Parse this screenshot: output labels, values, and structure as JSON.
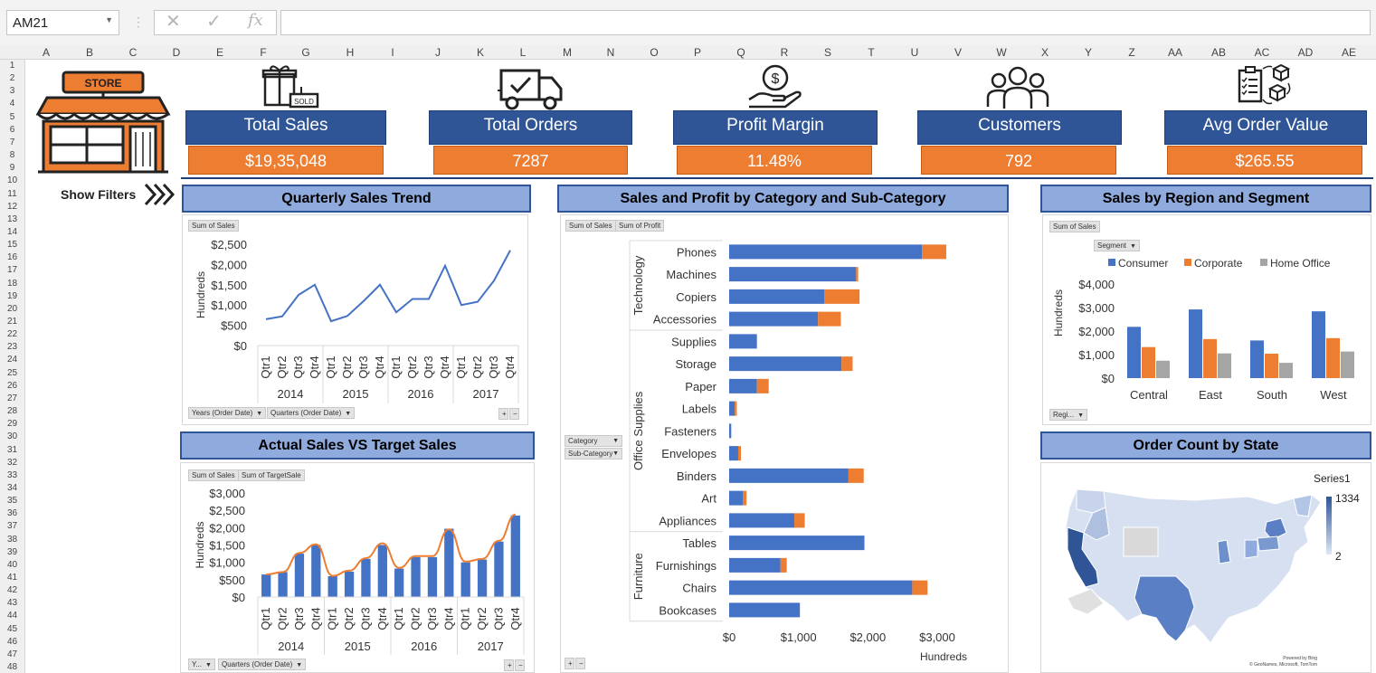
{
  "formula_bar": {
    "name_box": "AM21",
    "fx_label": "fx"
  },
  "columns": [
    "A",
    "B",
    "C",
    "D",
    "E",
    "F",
    "G",
    "H",
    "I",
    "J",
    "K",
    "L",
    "M",
    "N",
    "O",
    "P",
    "Q",
    "R",
    "S",
    "T",
    "U",
    "V",
    "W",
    "X",
    "Y",
    "Z",
    "AA",
    "AB",
    "AC",
    "AD",
    "AE"
  ],
  "rows": [
    "1",
    "2",
    "3",
    "4",
    "5",
    "6",
    "7",
    "8",
    "9",
    "10",
    "11",
    "12",
    "13",
    "14",
    "15",
    "16",
    "17",
    "18",
    "19",
    "20",
    "21",
    "22",
    "23",
    "24",
    "25",
    "26",
    "27",
    "28",
    "29",
    "30",
    "31",
    "32",
    "33",
    "34",
    "35",
    "36",
    "37",
    "38",
    "39",
    "40",
    "41",
    "42",
    "43",
    "44",
    "45",
    "46",
    "47",
    "48"
  ],
  "store": {
    "sign": "STORE",
    "sold_tag": "SOLD"
  },
  "kpis": [
    {
      "label": "Total Sales",
      "value": "$19,35,048",
      "icon": "gift-box-icon"
    },
    {
      "label": "Total Orders",
      "value": "7287",
      "icon": "delivery-truck-icon"
    },
    {
      "label": "Profit Margin",
      "value": "11.48%",
      "icon": "hand-money-icon"
    },
    {
      "label": "Customers",
      "value": "792",
      "icon": "users-group-icon"
    },
    {
      "label": "Avg Order Value",
      "value": "$265.55",
      "icon": "order-checklist-icon"
    }
  ],
  "show_filters": "Show Filters",
  "colors": {
    "blue": "#4472c4",
    "orange": "#ed7d31",
    "gray": "#a5a5a5",
    "kpi_head": "#2f5597",
    "title_fill": "#8faadc"
  },
  "quarterly": {
    "title": "Quarterly Sales Trend",
    "pill_value": "Sum of Sales",
    "filters": [
      "Years (Order Date)",
      "Quarters (Order Date)"
    ],
    "chart_data": {
      "type": "line",
      "ylabel": "Hundreds",
      "ylim": [
        0,
        2500
      ],
      "yticks": [
        "$2,500",
        "$2,000",
        "$1,500",
        "$1,000",
        "$500",
        "$0"
      ],
      "categories": [
        "Qtr1",
        "Qtr2",
        "Qtr3",
        "Qtr4",
        "Qtr1",
        "Qtr2",
        "Qtr3",
        "Qtr4",
        "Qtr1",
        "Qtr2",
        "Qtr3",
        "Qtr4",
        "Qtr1",
        "Qtr2",
        "Qtr3",
        "Qtr4"
      ],
      "groups": [
        "2014",
        "2015",
        "2016",
        "2017"
      ],
      "values": [
        650,
        720,
        1250,
        1500,
        600,
        730,
        1100,
        1500,
        820,
        1150,
        1150,
        1970,
        1000,
        1080,
        1600,
        2350
      ]
    }
  },
  "actual_target": {
    "title": "Actual Sales VS Target Sales",
    "pills": [
      "Sum of Sales",
      "Sum of TargetSale"
    ],
    "filters": [
      "Y...",
      "Quarters (Order Date)"
    ],
    "chart_data": {
      "type": "bar",
      "ylabel": "Hundreds",
      "ylim": [
        0,
        3000
      ],
      "yticks": [
        "$3,000",
        "$2,500",
        "$2,000",
        "$1,500",
        "$1,000",
        "$500",
        "$0"
      ],
      "categories": [
        "Qtr1",
        "Qtr2",
        "Qtr3",
        "Qtr4",
        "Qtr1",
        "Qtr2",
        "Qtr3",
        "Qtr4",
        "Qtr1",
        "Qtr2",
        "Qtr3",
        "Qtr4",
        "Qtr1",
        "Qtr2",
        "Qtr3",
        "Qtr4"
      ],
      "groups": [
        "2014",
        "2015",
        "2016",
        "2017"
      ],
      "series": [
        {
          "values": [
            650,
            720,
            1250,
            1500,
            600,
            730,
            1100,
            1500,
            820,
            1150,
            1150,
            1970,
            1000,
            1080,
            1600,
            2350
          ]
        },
        {
          "values": [
            650,
            720,
            1270,
            1520,
            610,
            760,
            1120,
            1550,
            840,
            1180,
            1180,
            1950,
            1020,
            1100,
            1620,
            2380
          ]
        }
      ]
    }
  },
  "category": {
    "title": "Sales and Profit by Category and Sub-Category",
    "pills": [
      "Sum of Sales",
      "Sum of Profit"
    ],
    "filters": [
      "Category",
      "Sub-Category"
    ],
    "chart_data": {
      "type": "bar",
      "orientation": "horizontal",
      "stacked": true,
      "xlabel": "Hundreds",
      "xlim": [
        0,
        3000
      ],
      "xticks": [
        "$0",
        "$1,000",
        "$2,000",
        "$3,000"
      ],
      "groups": [
        {
          "name": "Technology",
          "items": [
            "Phones",
            "Machines",
            "Copiers",
            "Accessories"
          ]
        },
        {
          "name": "Office Supplies",
          "items": [
            "Supplies",
            "Storage",
            "Paper",
            "Labels",
            "Fasteners",
            "Envelopes",
            "Binders",
            "Art",
            "Appliances"
          ]
        },
        {
          "name": "Furniture",
          "items": [
            "Tables",
            "Furnishings",
            "Chairs",
            "Bookcases"
          ]
        }
      ],
      "series": [
        {
          "values": [
            2780,
            1830,
            1370,
            1280,
            400,
            1620,
            400,
            80,
            30,
            130,
            1720,
            200,
            940,
            1950,
            740,
            2640,
            1020
          ]
        },
        {
          "values": [
            350,
            30,
            510,
            330,
            0,
            160,
            170,
            30,
            0,
            40,
            220,
            50,
            150,
            0,
            90,
            220,
            0
          ]
        }
      ]
    }
  },
  "region": {
    "title": "Sales by Region and Segment",
    "pill_value": "Sum of Sales",
    "pill_segment": "Segment",
    "pill_region": "Regi...",
    "chart_data": {
      "type": "bar",
      "ylabel": "Hundreds",
      "ylim": [
        0,
        4000
      ],
      "yticks": [
        "$4,000",
        "$3,000",
        "$2,000",
        "$1,000",
        "$0"
      ],
      "categories": [
        "Central",
        "East",
        "South",
        "West"
      ],
      "series": [
        {
          "name": "Consumer",
          "values": [
            2180,
            2920,
            1600,
            2840
          ]
        },
        {
          "name": "Corporate",
          "values": [
            1320,
            1660,
            1040,
            1700
          ]
        },
        {
          "name": "Home Office",
          "values": [
            740,
            1050,
            650,
            1130
          ]
        }
      ]
    }
  },
  "map": {
    "title": "Order Count by State",
    "legend_title": "Series1",
    "legend_max": "1334",
    "legend_min": "2",
    "credit_line1": "Powered by Bing",
    "credit_line2": "© GeoNames, Microsoft, TomTom"
  },
  "pivot_buttons": {
    "plus": "+",
    "minus": "−"
  }
}
